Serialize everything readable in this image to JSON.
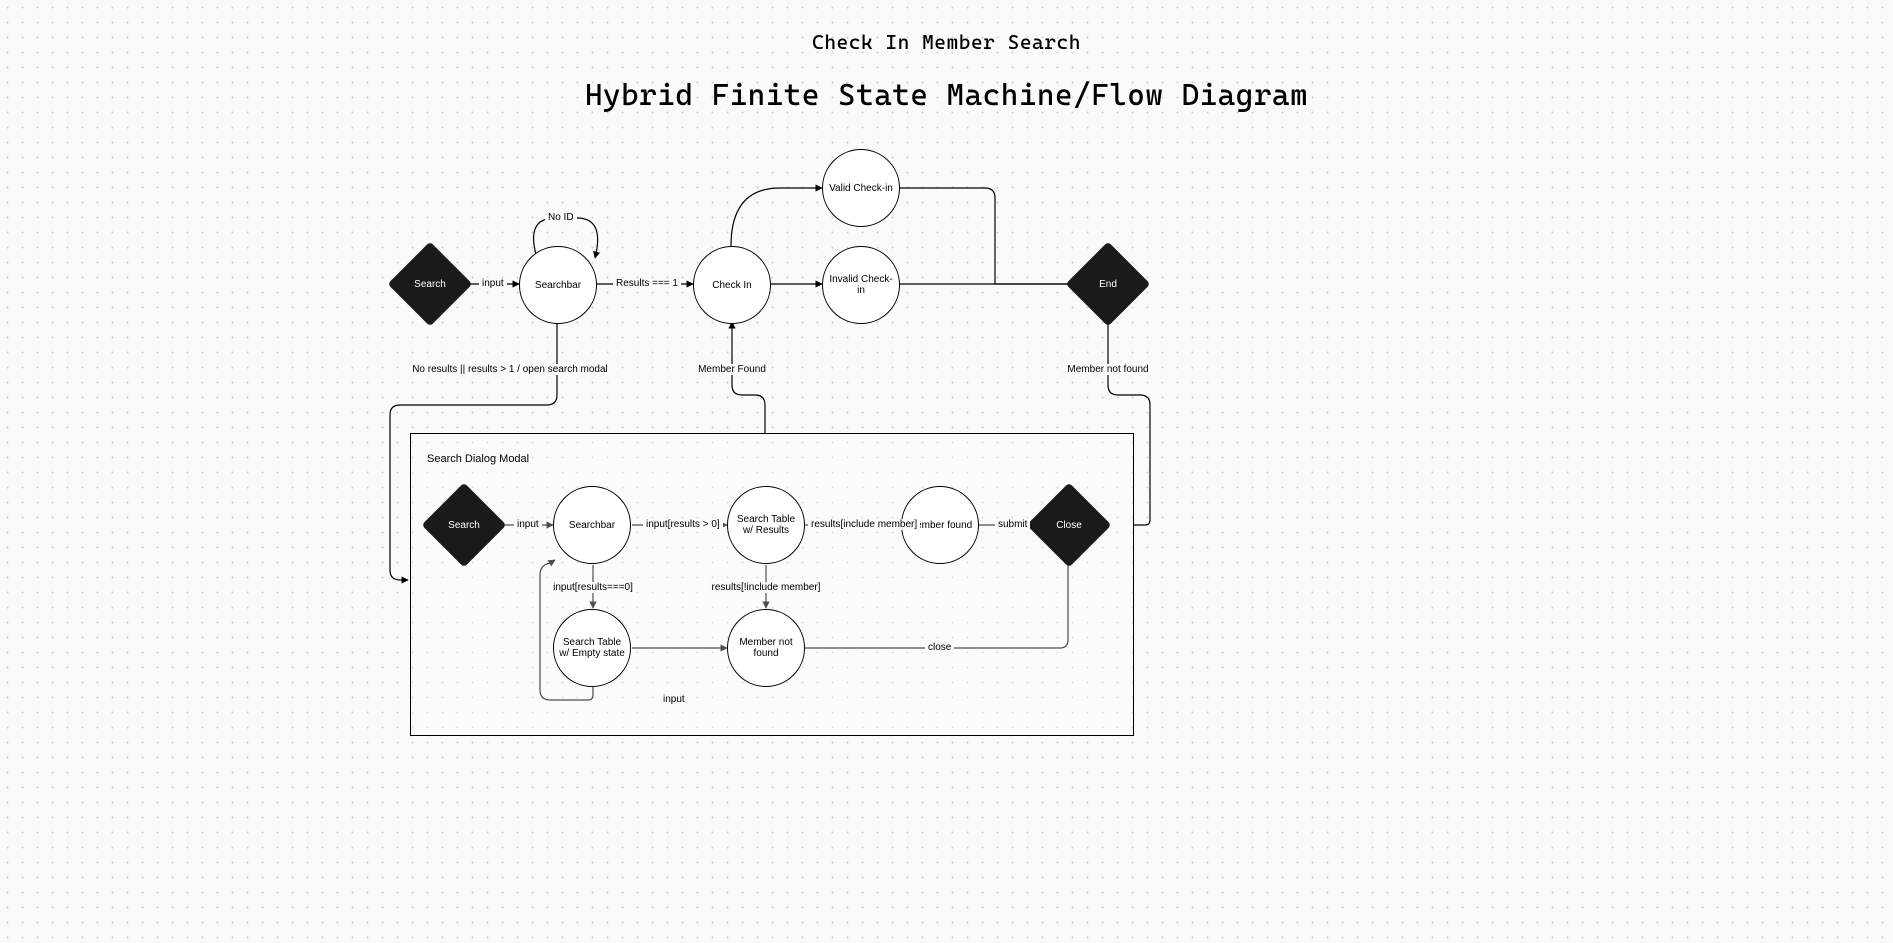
{
  "header": {
    "subtitle": "Check In Member Search",
    "title": "Hybrid Finite State Machine/Flow Diagram"
  },
  "nodes": {
    "search_start": "Search",
    "searchbar_top": "Searchbar",
    "check_in": "Check In",
    "valid_checkin": "Valid Check-in",
    "invalid_checkin": "Invalid Check-in",
    "end": "End",
    "modal_title": "Search Dialog Modal",
    "search_modal": "Search",
    "searchbar_modal": "Searchbar",
    "search_table_results": "Search Table w/ Results",
    "member_found": "Member found",
    "close": "Close",
    "search_table_empty": "Search Table w/ Empty state",
    "member_not_found": "Member not found"
  },
  "edges": {
    "input1": "input",
    "no_id": "No ID",
    "results_eq_1": "Results === 1",
    "no_results_gt1": "No results || results > 1 / open search modal",
    "member_found_edge": "Member Found",
    "member_not_found_edge": "Member not found",
    "input2": "input",
    "input_results_gt0": "input[results > 0]",
    "results_include": "results[include member]",
    "submit": "submit",
    "input_results_eq0": "input[results===0]",
    "results_not_include": "results[!include member]",
    "close_edge": "close",
    "input3": "input"
  }
}
